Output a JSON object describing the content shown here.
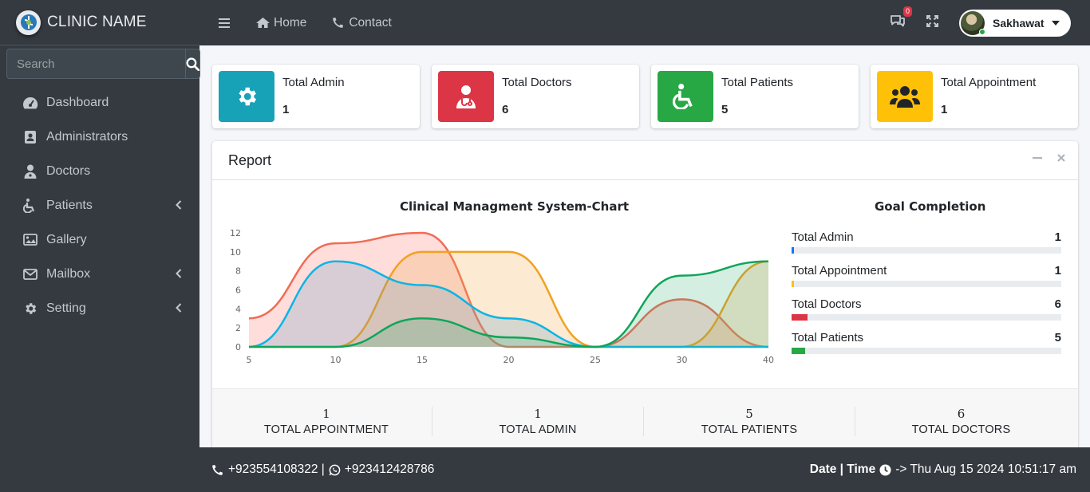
{
  "brand": {
    "name": "CLINIC NAME"
  },
  "sidebar": {
    "search_placeholder": "Search",
    "items": [
      {
        "label": "Dashboard",
        "icon": "tachometer-icon",
        "has_children": false
      },
      {
        "label": "Administrators",
        "icon": "id-card-icon",
        "has_children": false
      },
      {
        "label": "Doctors",
        "icon": "user-doctor-icon",
        "has_children": false
      },
      {
        "label": "Patients",
        "icon": "wheelchair-icon",
        "has_children": true
      },
      {
        "label": "Gallery",
        "icon": "image-icon",
        "has_children": false
      },
      {
        "label": "Mailbox",
        "icon": "envelope-icon",
        "has_children": true
      },
      {
        "label": "Setting",
        "icon": "gear-icon",
        "has_children": true
      }
    ]
  },
  "topbar": {
    "home_label": "Home",
    "contact_label": "Contact",
    "notification_count": "0",
    "user_name": "Sakhawat"
  },
  "info_boxes": [
    {
      "label": "Total Admin",
      "value": "1",
      "color": "#17a2b8",
      "icon": "gear-icon"
    },
    {
      "label": "Total Doctors",
      "value": "6",
      "color": "#dc3545",
      "icon": "user-doctor-icon"
    },
    {
      "label": "Total Patients",
      "value": "5",
      "color": "#28a745",
      "icon": "wheelchair-icon"
    },
    {
      "label": "Total Appointment",
      "value": "1",
      "color": "#ffc107",
      "icon": "users-icon"
    }
  ],
  "report": {
    "title": "Report",
    "chart_title": "Clinical Managment System-Chart",
    "goal_title": "Goal Completion",
    "goals": [
      {
        "label": "Total Admin",
        "value": "1",
        "percent": 1,
        "color": "#007bff"
      },
      {
        "label": "Total Appointment",
        "value": "1",
        "percent": 1,
        "color": "#ffc107"
      },
      {
        "label": "Total Doctors",
        "value": "6",
        "percent": 6,
        "color": "#dc3545"
      },
      {
        "label": "Total Patients",
        "value": "5",
        "percent": 5,
        "color": "#28a745"
      }
    ],
    "stats": [
      {
        "value": "1",
        "label": "TOTAL APPOINTMENT"
      },
      {
        "value": "1",
        "label": "TOTAL ADMIN"
      },
      {
        "value": "5",
        "label": "TOTAL PATIENTS"
      },
      {
        "value": "6",
        "label": "TOTAL DOCTORS"
      }
    ]
  },
  "chart_data": {
    "type": "area",
    "x": [
      5,
      10,
      15,
      20,
      25,
      30,
      40
    ],
    "x_ticks": [
      "5",
      "10",
      "15",
      "20",
      "25",
      "30",
      "40"
    ],
    "y_ticks": [
      "0",
      "2",
      "4",
      "6",
      "8",
      "10",
      "12"
    ],
    "ylim": [
      0,
      12
    ],
    "grid": false,
    "series": [
      {
        "values": [
          3,
          10.9,
          12,
          0,
          0,
          5,
          0
        ],
        "color": "#f06c55",
        "fill": "rgba(250,120,110,0.25)"
      },
      {
        "values": [
          0,
          0,
          10,
          10,
          0,
          0,
          9
        ],
        "color": "#f2a11f",
        "fill": "rgba(245,170,80,0.25)"
      },
      {
        "values": [
          0,
          9,
          6.5,
          3,
          0,
          0,
          0
        ],
        "color": "#0ab5e6",
        "fill": "rgba(80,150,190,0.22)"
      },
      {
        "values": [
          0,
          0,
          3,
          1,
          0,
          7.5,
          9
        ],
        "color": "#0ea55a",
        "fill": "rgba(40,170,110,0.2)"
      }
    ]
  },
  "footer": {
    "phone": "+923554108322 |",
    "whatsapp": "+923412428786",
    "datetime_label": "Date | Time",
    "datetime_value": "-> Thu Aug 15 2024 10:51:17 am"
  }
}
